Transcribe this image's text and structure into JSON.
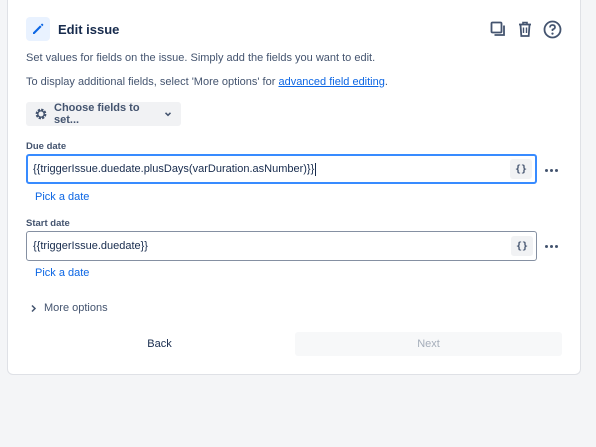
{
  "header": {
    "title": "Edit issue"
  },
  "description": {
    "line1": "Set values for fields on the issue. Simply add the fields you want to edit.",
    "line2_prefix": "To display additional fields, select 'More options' for ",
    "line2_link": "advanced field editing",
    "line2_suffix": "."
  },
  "choose_fields": {
    "label": "Choose fields to set..."
  },
  "fields": [
    {
      "label": "Due date",
      "value": "{{triggerIssue.duedate.plusDays(varDuration.asNumber)}}",
      "code_label": "{}",
      "pick_label": "Pick a date"
    },
    {
      "label": "Start date",
      "value": "{{triggerIssue.duedate}}",
      "code_label": "{}",
      "pick_label": "Pick a date"
    }
  ],
  "more_options": {
    "label": "More options"
  },
  "footer": {
    "back_label": "Back",
    "next_label": "Next"
  },
  "colors": {
    "accent": "#0c66e4",
    "focus_border": "#388bff",
    "text": "#172b4d",
    "subtle_text": "#44546f"
  },
  "icons": {
    "header": [
      "pencil-icon",
      "duplicate-icon",
      "trash-icon",
      "help-icon"
    ],
    "choose_fields": [
      "gear-icon",
      "chevron-down-icon"
    ],
    "more_options": "chevron-right-icon"
  }
}
